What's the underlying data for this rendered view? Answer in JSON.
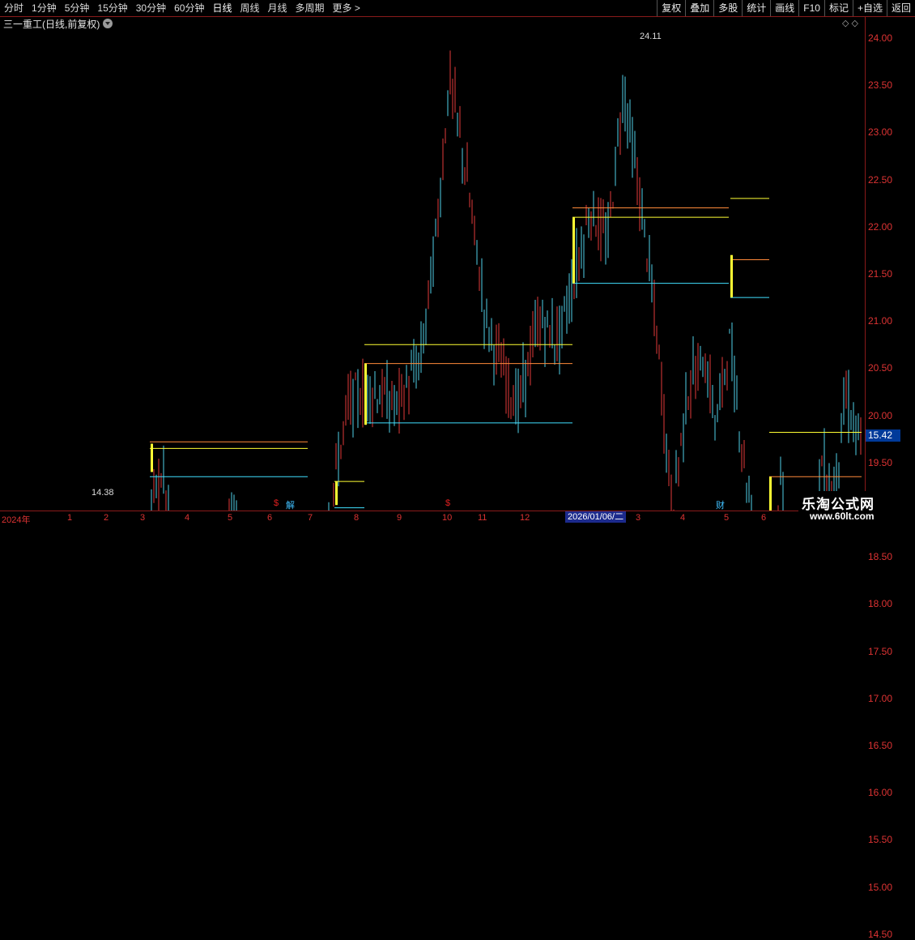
{
  "toolbar": {
    "periods": [
      "分时",
      "1分钟",
      "5分钟",
      "15分钟",
      "30分钟",
      "60分钟",
      "日线",
      "周线",
      "月线",
      "多周期",
      "更多"
    ],
    "more_arrow": ">",
    "active_period": "日线",
    "buttons": [
      "复权",
      "叠加",
      "多股",
      "统计",
      "画线",
      "F10",
      "标记",
      "+自选",
      "返回"
    ]
  },
  "title": {
    "text": "三一重工(日线,前复权)"
  },
  "corner_controls": "◇ ◇",
  "axis": {
    "price_labels": [
      "24.00",
      "23.50",
      "23.00",
      "22.50",
      "22.00",
      "21.50",
      "21.00",
      "20.50",
      "20.00",
      "19.50",
      "19.00",
      "18.50",
      "18.00",
      "17.50",
      "17.00",
      "16.50",
      "16.00",
      "15.50",
      "15.00",
      "14.50"
    ],
    "current_price": "15.42",
    "x_labels": [
      "2024年",
      "1",
      "2",
      "3",
      "4",
      "5",
      "6",
      "7",
      "8",
      "9",
      "10",
      "11",
      "12",
      "3",
      "4",
      "5",
      "6"
    ],
    "date_cursor": "2026/01/06/二"
  },
  "annotations": {
    "high": "24.11",
    "low": "14.38"
  },
  "markers": [
    {
      "text": "$",
      "color": "#e02020"
    },
    {
      "text": "解",
      "color": "#40c0ff"
    },
    {
      "text": "$",
      "color": "#e02020"
    },
    {
      "text": "财",
      "color": "#40c0ff"
    }
  ],
  "watermark": {
    "line1": "乐淘公式网",
    "line2": "www.60lt.com"
  },
  "colors": {
    "up": "#e23a3a",
    "down": "#4fd1e8",
    "yellow": "#ffff33",
    "orange": "#ff8a3a",
    "cyan": "#40e0ff"
  }
}
